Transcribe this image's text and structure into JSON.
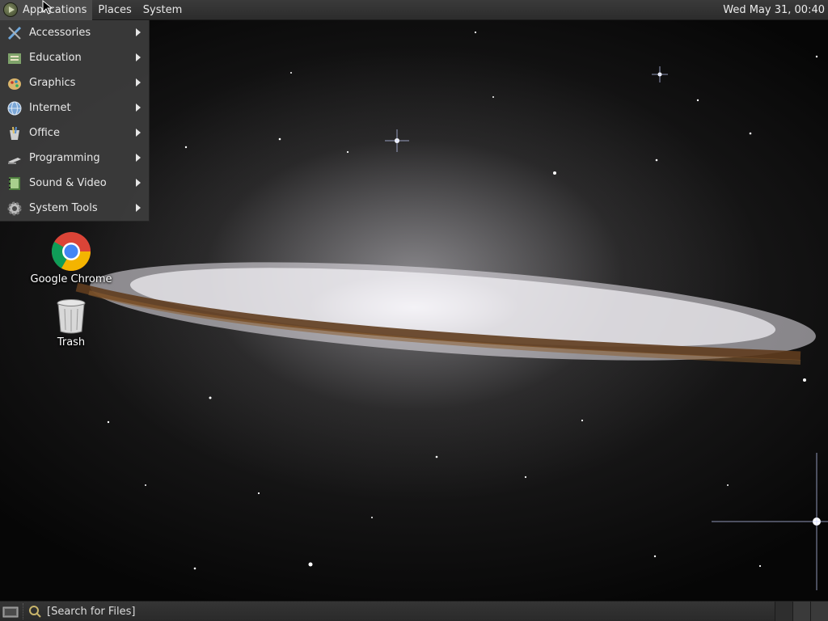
{
  "top_panel": {
    "menus": [
      "Applications",
      "Places",
      "System"
    ],
    "clock": "Wed May 31, 00:40"
  },
  "applications_menu": {
    "items": [
      {
        "label": "Accessories",
        "icon": "accessories-icon"
      },
      {
        "label": "Education",
        "icon": "education-icon"
      },
      {
        "label": "Graphics",
        "icon": "graphics-icon"
      },
      {
        "label": "Internet",
        "icon": "internet-globe-icon"
      },
      {
        "label": "Office",
        "icon": "office-icon"
      },
      {
        "label": "Programming",
        "icon": "programming-icon"
      },
      {
        "label": "Sound & Video",
        "icon": "sound-video-icon"
      },
      {
        "label": "System Tools",
        "icon": "system-tools-gear-icon"
      }
    ]
  },
  "desktop": {
    "icons": [
      {
        "label": "Google Chrome",
        "icon": "chrome-icon"
      },
      {
        "label": "Trash",
        "icon": "trash-icon"
      }
    ]
  },
  "bottom_panel": {
    "search_placeholder": "[Search for Files]",
    "workspace_count": 3
  },
  "colors": {
    "panel_bg": "#2e2e2e",
    "menu_bg": "#3c3c3c",
    "text": "#e6e6e6"
  }
}
